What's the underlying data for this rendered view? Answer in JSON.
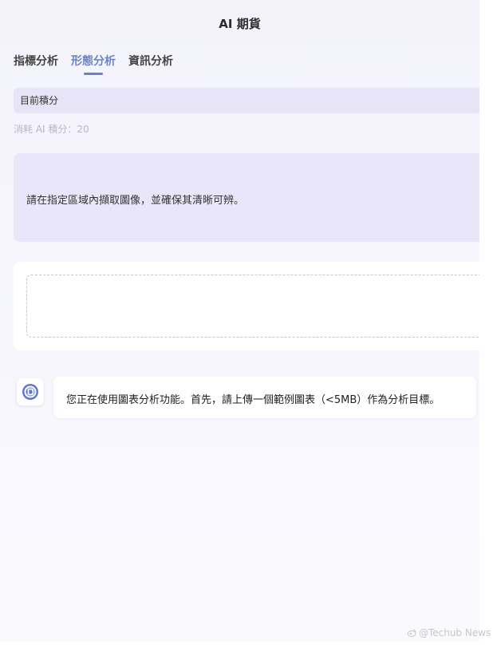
{
  "header": {
    "title": "AI 期貨"
  },
  "tabs": [
    {
      "label": "指標分析",
      "active": false
    },
    {
      "label": "形態分析",
      "active": true
    },
    {
      "label": "資訊分析",
      "active": false
    }
  ],
  "points": {
    "label": "目前積分"
  },
  "consume": {
    "text": "消耗 AI 積分：20"
  },
  "notice": {
    "text": "請在指定區域內擷取圖像，並確保其清晰可辨。"
  },
  "chat": {
    "avatar_icon": "bot-logo-icon",
    "message": "您正在使用圖表分析功能。首先，請上傳一個範例圖表（<5MB）作為分析目標。"
  },
  "watermark": {
    "text": "@Techub News",
    "icon": "weibo-icon"
  },
  "colors": {
    "accent": "#6a83c7",
    "panel": "#e8e6f8"
  }
}
